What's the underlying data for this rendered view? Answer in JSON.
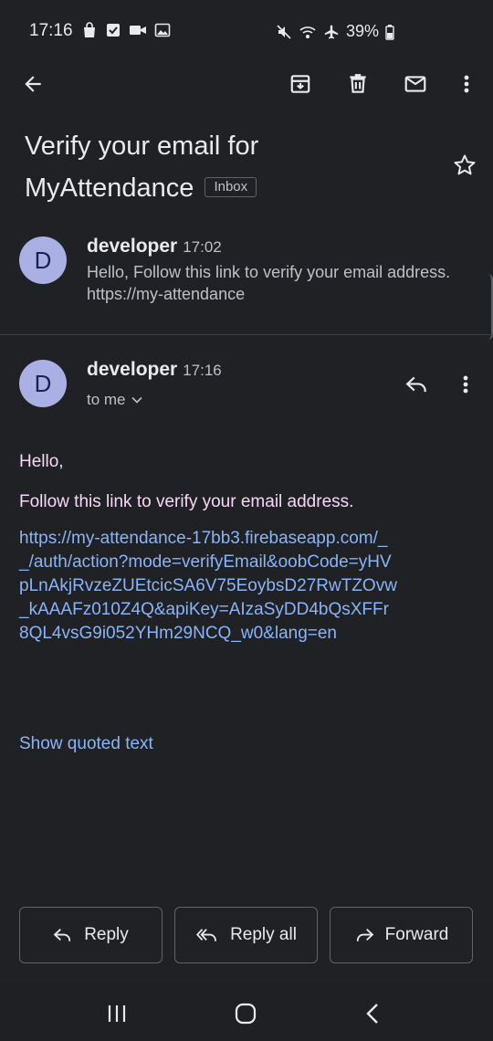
{
  "status_bar": {
    "time": "17:16",
    "battery": "39%",
    "left_icons": [
      "bag-icon",
      "checkbox-icon",
      "video-icon",
      "image-icon"
    ],
    "right_icons": [
      "mute-icon",
      "wifi-icon",
      "airplane-icon",
      "battery-icon"
    ]
  },
  "toolbar": {
    "icons": [
      "back-arrow-icon",
      "archive-icon",
      "delete-icon",
      "mark-unread-icon",
      "more-vert-icon"
    ]
  },
  "subject": {
    "title": "Verify your email for MyAttendance",
    "label": "Inbox"
  },
  "message_collapsed": {
    "avatar_letter": "D",
    "sender": "developer",
    "time": "17:02",
    "snippet": "Hello, Follow this link to verify your email address. https://my-attendance"
  },
  "message_expanded": {
    "avatar_letter": "D",
    "sender": "developer",
    "time": "17:16",
    "recipient": "to me",
    "greeting": "Hello,",
    "line1": "Follow this link to verify your email address.",
    "link": "https://my-attendance-17bb3.firebaseapp.com/__/auth/action?mode=verifyEmail&oobCode=yHVpLnAkjRvzeZUEtcicSA6V75EoybsD27RwTZOvw_kAAAFz010Z4Q&apiKey=AIzaSyDD4bQsXFFr8QL4vsG9i052YHm29NCQ_w0&lang=en",
    "show_quoted": "Show quoted text"
  },
  "actions": {
    "reply": "Reply",
    "reply_all": "Reply all",
    "forward": "Forward"
  },
  "colors": {
    "background": "#202124",
    "link": "#8ab4f8",
    "avatar": "#aab0e4",
    "body_text": "#f8d7f8"
  }
}
